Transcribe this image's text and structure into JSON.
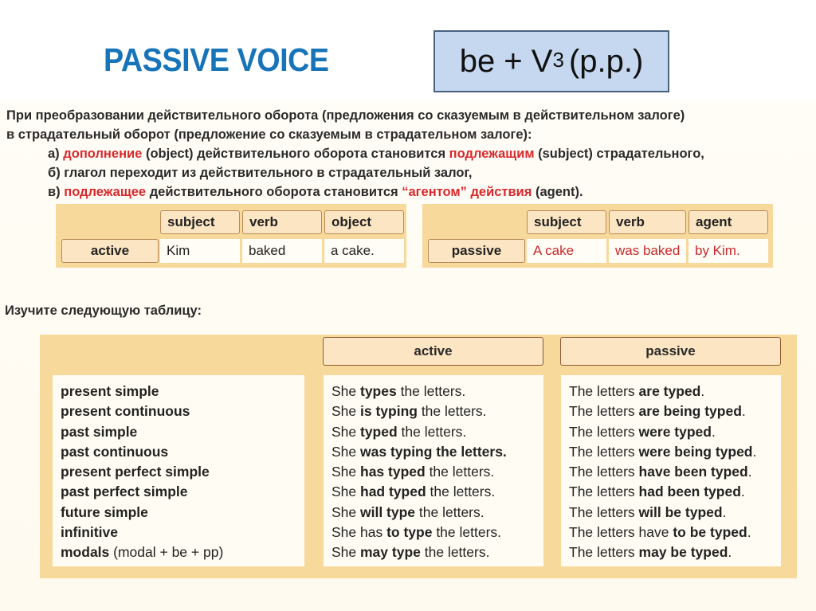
{
  "header": {
    "title": "PASSIVE VOICE",
    "formula_main": "be + V",
    "formula_sub": "3",
    "formula_tail": "(p.p.)"
  },
  "intro": {
    "line1": "При преобразовании действительного оборота (предложения со сказуемым в действительном залоге)",
    "line2": "в страдательный оборот (предложение со сказуемым в страдательном залоге):",
    "a_prefix": "а) ",
    "a_red1": "дополнение",
    "a_mid": " (object) действительного оборота становится ",
    "a_red2": "подлежащим",
    "a_tail": " (subject) страдательного,",
    "b_line": "б) глагол переходит из действительного в страдательный залог,",
    "c_prefix": "в) ",
    "c_red1": "подлежащее",
    "c_mid": " действительного оборота становится ",
    "c_red2": "“агентом” действия",
    "c_tail": " (agent)."
  },
  "example_active": {
    "label": "active",
    "headers": [
      "subject",
      "verb",
      "object"
    ],
    "values": [
      "Kim",
      "baked",
      "a cake."
    ]
  },
  "example_passive": {
    "label": "passive",
    "headers": [
      "subject",
      "verb",
      "agent"
    ],
    "values": [
      "A cake",
      "was baked",
      "by Kim."
    ]
  },
  "study_label": "Изучите следующую таблицу:",
  "table": {
    "col_active": "active",
    "col_passive": "passive",
    "rows": [
      {
        "tense": "present simple",
        "tense_note": "",
        "a1": "She ",
        "a2": "types",
        "a3": " the letters.",
        "p1": "The letters ",
        "p2": "are typed",
        "p3": "."
      },
      {
        "tense": "present continuous",
        "tense_note": "",
        "a1": "She ",
        "a2": "is typing",
        "a3": " the letters.",
        "p1": "The letters ",
        "p2": "are being typed",
        "p3": "."
      },
      {
        "tense": "past simple",
        "tense_note": "",
        "a1": "She ",
        "a2": "typed",
        "a3": " the letters.",
        "p1": "The letters ",
        "p2": "were typed",
        "p3": "."
      },
      {
        "tense": "past continuous",
        "tense_note": "",
        "a1": "She ",
        "a2": "was typing the letters.",
        "a3": "",
        "p1": "The letters ",
        "p2": "were being typed",
        "p3": "."
      },
      {
        "tense": "present perfect simple",
        "tense_note": "",
        "a1": "She ",
        "a2": "has typed",
        "a3": " the letters.",
        "p1": "The letters ",
        "p2": "have been typed",
        "p3": "."
      },
      {
        "tense": "past perfect simple",
        "tense_note": "",
        "a1": "She ",
        "a2": "had typed",
        "a3": " the letters.",
        "p1": "The letters ",
        "p2": "had been typed",
        "p3": "."
      },
      {
        "tense": "future simple",
        "tense_note": "",
        "a1": "She ",
        "a2": "will type",
        "a3": " the letters.",
        "p1": "The letters ",
        "p2": "will be typed",
        "p3": "."
      },
      {
        "tense": "infinitive",
        "tense_note": "",
        "a1": "She has ",
        "a2": "to type",
        "a3": " the letters.",
        "p1": "The letters have ",
        "p2": "to be typed",
        "p3": "."
      },
      {
        "tense": "modals",
        "tense_note": " (modal + be + pp)",
        "a1": "She ",
        "a2": "may type",
        "a3": " the letters.",
        "p1": "The letters ",
        "p2": "may be typed",
        "p3": "."
      }
    ]
  }
}
